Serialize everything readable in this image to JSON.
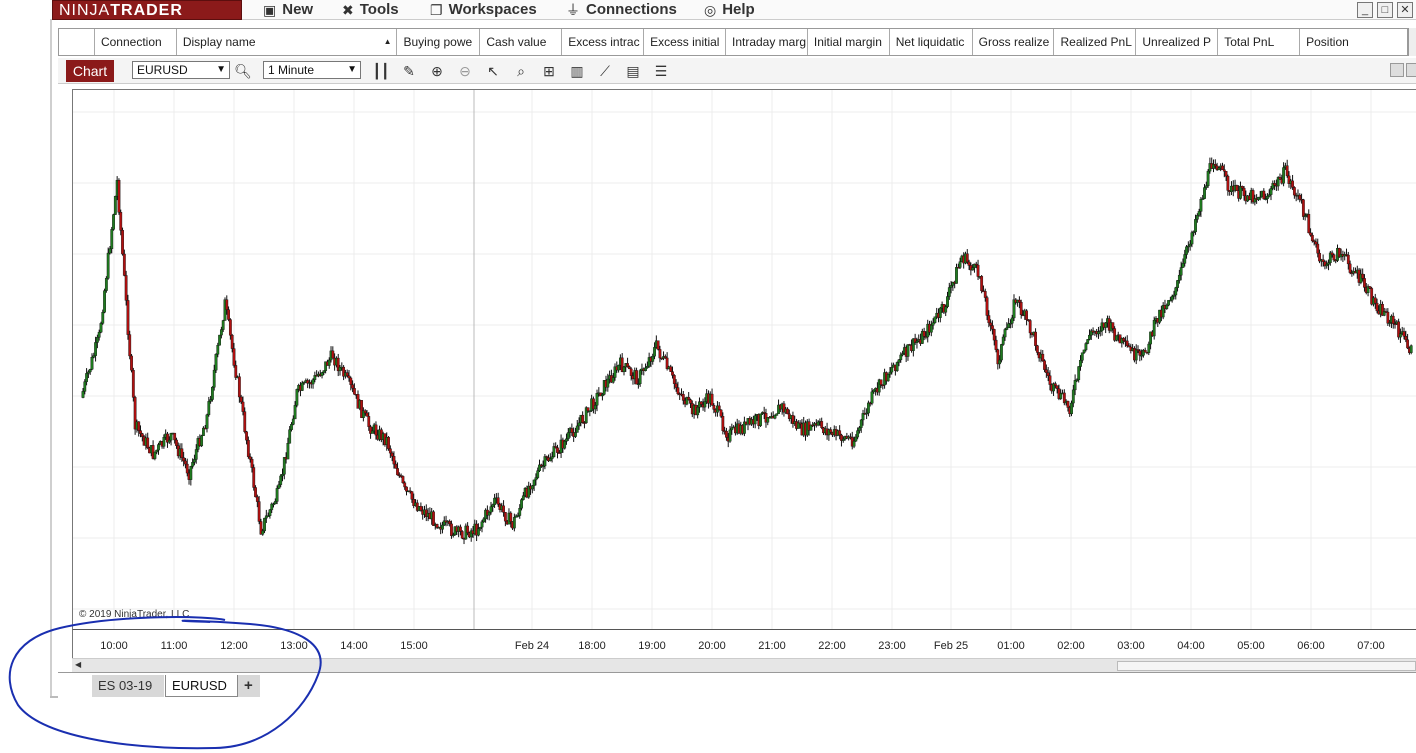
{
  "app": {
    "logo_part1": "NINJA",
    "logo_part2": "TRADER"
  },
  "menu": [
    {
      "label": "New",
      "icon": "new-window-icon",
      "glyph": "▣"
    },
    {
      "label": "Tools",
      "icon": "tools-icon",
      "glyph": "✖"
    },
    {
      "label": "Workspaces",
      "icon": "workspaces-icon",
      "glyph": "❐"
    },
    {
      "label": "Connections",
      "icon": "connections-plug-icon",
      "glyph": "⏚"
    },
    {
      "label": "Help",
      "icon": "help-lifebuoy-icon",
      "glyph": "◎"
    }
  ],
  "accounts_grid": {
    "columns": [
      "",
      "Connection",
      "Display name",
      "Buying powe",
      "Cash value",
      "Excess intrac",
      "Excess initial",
      "Intraday marg",
      "Initial margin",
      "Net liquidatic",
      "Gross realize",
      "Realized PnL",
      "Unrealized P",
      "Total PnL",
      "Position"
    ]
  },
  "chart_toolbar": {
    "tab_label": "Chart",
    "instrument": "EURUSD",
    "interval": "1 Minute"
  },
  "colors": {
    "brand": "#8b1a1a",
    "up_candle": "#1f7a1f",
    "down_candle": "#b01010",
    "annotation": "#1a2fb0"
  },
  "chart": {
    "copyright": "© 2019 NinjaTrader, LLC",
    "x_ticks": [
      "10:00",
      "11:00",
      "12:00",
      "13:00",
      "14:00",
      "15:00",
      "Feb 24",
      "18:00",
      "19:00",
      "20:00",
      "21:00",
      "22:00",
      "23:00",
      "Feb 25",
      "01:00",
      "02:00",
      "03:00",
      "04:00",
      "05:00",
      "06:00",
      "07:00"
    ]
  },
  "chart_data": {
    "type": "line",
    "instrument": "EURUSD",
    "interval": "1 Minute",
    "x": [
      "09:40",
      "09:50",
      "10:00",
      "10:10",
      "10:20",
      "10:30",
      "10:40",
      "11:00",
      "11:05",
      "11:15",
      "11:30",
      "11:40",
      "12:00",
      "12:30",
      "12:50",
      "13:05",
      "13:30",
      "13:50",
      "14:20",
      "14:40",
      "15:00",
      "15:20",
      "15:40",
      "Feb 24 17:00",
      "17:10",
      "17:30",
      "17:50",
      "18:00",
      "18:15",
      "18:40",
      "19:00",
      "19:20",
      "19:45",
      "20:00",
      "20:20",
      "20:40",
      "21:00",
      "21:30",
      "21:50",
      "22:10",
      "22:30",
      "23:00",
      "23:30",
      "23:40",
      "Feb 25 00:00",
      "00:20",
      "00:40",
      "00:55",
      "01:05",
      "01:20",
      "01:45",
      "02:00",
      "02:10",
      "02:30",
      "02:50",
      "03:00",
      "03:10",
      "03:30",
      "03:50",
      "04:00",
      "04:15",
      "04:30",
      "04:45",
      "04:55",
      "05:10",
      "05:30",
      "05:45",
      "05:55",
      "06:10",
      "06:30",
      "06:45",
      "07:00",
      "07:20",
      "07:40",
      "07:45"
    ],
    "y": [
      0.42,
      0.55,
      0.88,
      0.36,
      0.3,
      0.34,
      0.26,
      0.38,
      0.62,
      0.38,
      0.14,
      0.22,
      0.43,
      0.46,
      0.51,
      0.44,
      0.36,
      0.33,
      0.22,
      0.18,
      0.15,
      0.13,
      0.14,
      0.2,
      0.15,
      0.24,
      0.29,
      0.33,
      0.38,
      0.44,
      0.49,
      0.46,
      0.53,
      0.45,
      0.39,
      0.42,
      0.34,
      0.36,
      0.38,
      0.4,
      0.35,
      0.36,
      0.34,
      0.33,
      0.42,
      0.48,
      0.52,
      0.56,
      0.61,
      0.72,
      0.68,
      0.5,
      0.63,
      0.55,
      0.44,
      0.4,
      0.55,
      0.58,
      0.53,
      0.5,
      0.6,
      0.66,
      0.8,
      0.93,
      0.86,
      0.85,
      0.85,
      0.9,
      0.82,
      0.7,
      0.73,
      0.68,
      0.62,
      0.58,
      0.52
    ],
    "y_scale_note": "relative price level (0=chart low, 1=chart high); y-axis price labels not visible",
    "x_ticks": [
      "10:00",
      "11:00",
      "12:00",
      "13:00",
      "14:00",
      "15:00",
      "Feb 24",
      "18:00",
      "19:00",
      "20:00",
      "21:00",
      "22:00",
      "23:00",
      "Feb 25",
      "01:00",
      "02:00",
      "03:00",
      "04:00",
      "05:00",
      "06:00",
      "07:00"
    ],
    "grid": true,
    "title": "",
    "xlabel": "",
    "ylabel": ""
  },
  "bottom_tabs": [
    {
      "label": "ES 03-19",
      "active": false
    },
    {
      "label": "EURUSD",
      "active": true
    }
  ],
  "add_tab_label": "+"
}
